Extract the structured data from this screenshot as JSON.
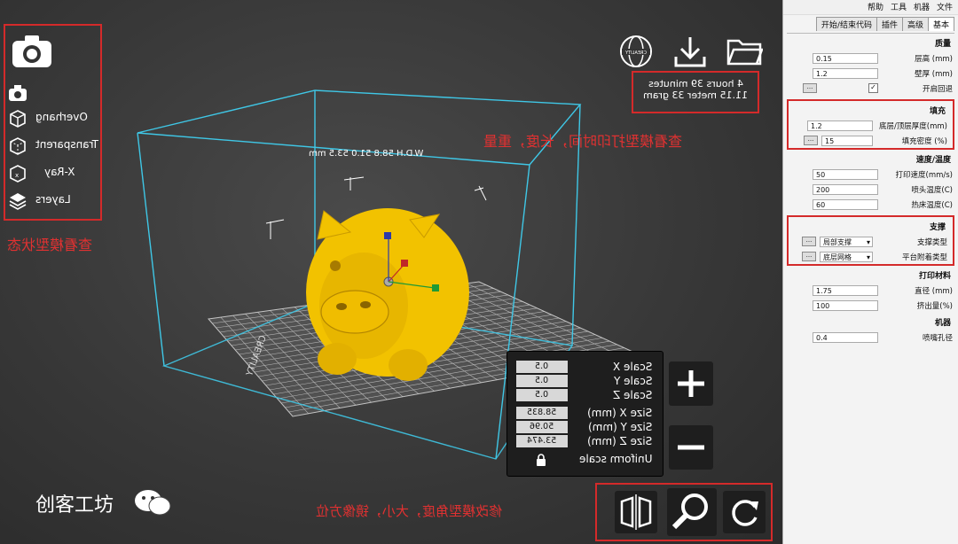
{
  "menu": {
    "items": [
      "文件",
      "机器",
      "工具",
      "帮助"
    ]
  },
  "settings_tabs": [
    "基本",
    "高级",
    "插件",
    "开始/结束代码"
  ],
  "sections": {
    "quality": {
      "title": "质量",
      "layer_height_label": "层高 (mm)",
      "layer_height": "0.15",
      "shell_label": "壁厚 (mm)",
      "shell": "1.2",
      "retraction_label": "开启回退",
      "retraction": "✓"
    },
    "fill": {
      "title": "填充",
      "bottom_top_label": "底层/顶层厚度(mm)",
      "bottom_top": "1.2",
      "density_label": "填充密度 (%)",
      "density": "15"
    },
    "speed": {
      "title": "速度/温度",
      "print_speed_label": "打印速度(mm/s)",
      "print_speed": "50",
      "nozzle_temp_label": "喷头温度(C)",
      "nozzle_temp": "200",
      "bed_temp_label": "热床温度(C)",
      "bed_temp": "60"
    },
    "support": {
      "title": "支撑",
      "support_type_label": "支撑类型",
      "support_type": "局部支撑",
      "adhesion_label": "平台附着类型",
      "adhesion": "底层网格"
    },
    "filament": {
      "title": "打印材料",
      "diameter_label": "直径 (mm)",
      "diameter": "1.75",
      "flow_label": "挤出量(%)",
      "flow": "100"
    },
    "machine": {
      "title": "机器",
      "nozzle_label": "喷嘴孔径",
      "nozzle": "0.4"
    }
  },
  "mini_button": "...",
  "view_modes": {
    "overhang": "Overhang",
    "transparent": "Transparent",
    "xray": "X-Ray",
    "layers": "Layers"
  },
  "print_info": {
    "time": "4 hours 39 minutes",
    "material": "11.15 meter 33 gram"
  },
  "dimensions": "W.D.H 58.8 51.0 53.5 mm",
  "scale_panel": {
    "scale_x_label": "Scale X",
    "scale_x": "0.5",
    "scale_y_label": "Scale Y",
    "scale_y": "0.5",
    "scale_z_label": "Scale Z",
    "scale_z": "0.5",
    "size_x_label": "Size X (mm)",
    "size_x": "58.835",
    "size_y_label": "Size Y (mm)",
    "size_y": "50.96",
    "size_z_label": "Size Z (mm)",
    "size_z": "53.474",
    "uniform_label": "Uniform scale"
  },
  "annotations": {
    "view_state": "查看模型状态",
    "print_info": "查看模型打印时间，长度，重量",
    "modify": "修改模型角度，大小，镜像方位"
  },
  "watermark": "创客工坊",
  "bed_logo": "CREALITY",
  "colors": {
    "accent_red": "#d42a2a",
    "model_yellow": "#f2c200",
    "box_cyan": "#3fc7e6"
  }
}
